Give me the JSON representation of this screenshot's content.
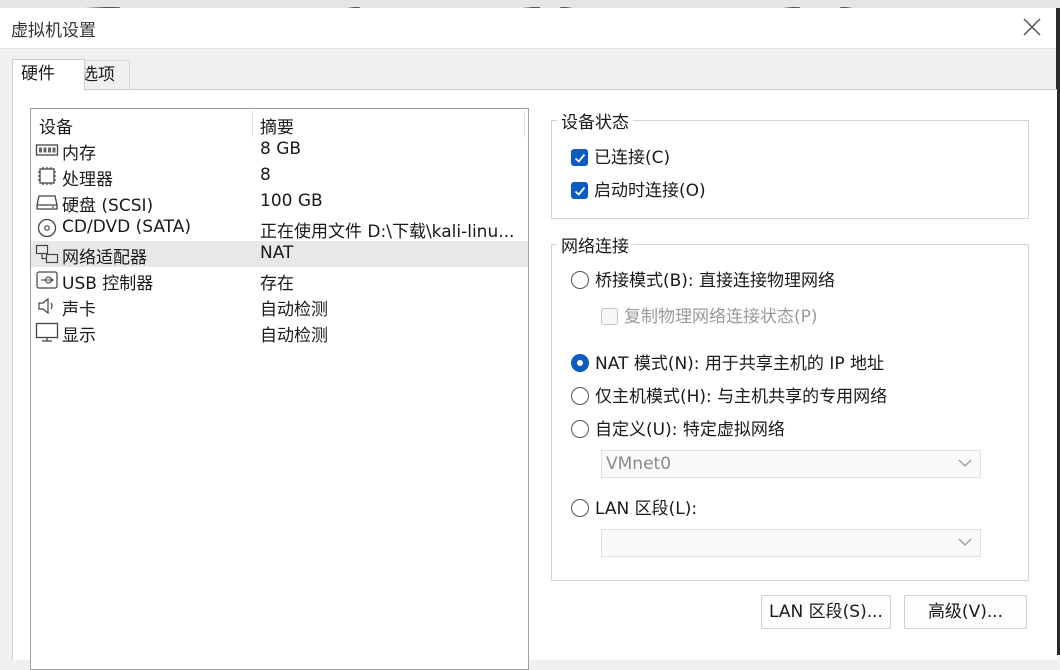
{
  "window": {
    "title": "虚拟机设置"
  },
  "tabs": [
    {
      "label": "硬件"
    },
    {
      "label": "选项"
    }
  ],
  "device_list": {
    "columns": [
      "设备",
      "摘要"
    ],
    "rows": [
      {
        "icon": "memory-icon",
        "name": "内存",
        "summary": "8 GB"
      },
      {
        "icon": "cpu-icon",
        "name": "处理器",
        "summary": "8"
      },
      {
        "icon": "hard-disk-icon",
        "name": "硬盘 (SCSI)",
        "summary": "100 GB"
      },
      {
        "icon": "cd-dvd-icon",
        "name": "CD/DVD (SATA)",
        "summary": "正在使用文件 D:\\下载\\kali-linu..."
      },
      {
        "icon": "network-adapter-icon",
        "name": "网络适配器",
        "summary": "NAT",
        "selected": true
      },
      {
        "icon": "usb-icon",
        "name": "USB 控制器",
        "summary": "存在"
      },
      {
        "icon": "speaker-icon",
        "name": "声卡",
        "summary": "自动检测"
      },
      {
        "icon": "monitor-icon",
        "name": "显示",
        "summary": "自动检测"
      }
    ]
  },
  "device_status": {
    "legend": "设备状态",
    "connected": {
      "label": "已连接(C)",
      "checked": true
    },
    "connect_at_power_on": {
      "label": "启动时连接(O)",
      "checked": true
    }
  },
  "network_connection": {
    "legend": "网络连接",
    "bridged": {
      "label": "桥接模式(B): 直接连接物理网络",
      "selected": false
    },
    "replicate_state": {
      "label": "复制物理网络连接状态(P)",
      "checked": false,
      "enabled": false
    },
    "nat": {
      "label": "NAT 模式(N): 用于共享主机的 IP 地址",
      "selected": true
    },
    "host_only": {
      "label": "仅主机模式(H): 与主机共享的专用网络",
      "selected": false
    },
    "custom": {
      "label": "自定义(U): 特定虚拟网络",
      "selected": false
    },
    "custom_select_value": "VMnet0",
    "lan_segment": {
      "label": "LAN 区段(L):",
      "selected": false
    },
    "lan_select_value": ""
  },
  "buttons": {
    "lan_segments": "LAN 区段(S)...",
    "advanced": "高级(V)..."
  },
  "colors": {
    "accent": "#0a5cc2",
    "selected_row": "#e8e8e8",
    "window_bg": "#f0f0f0"
  }
}
